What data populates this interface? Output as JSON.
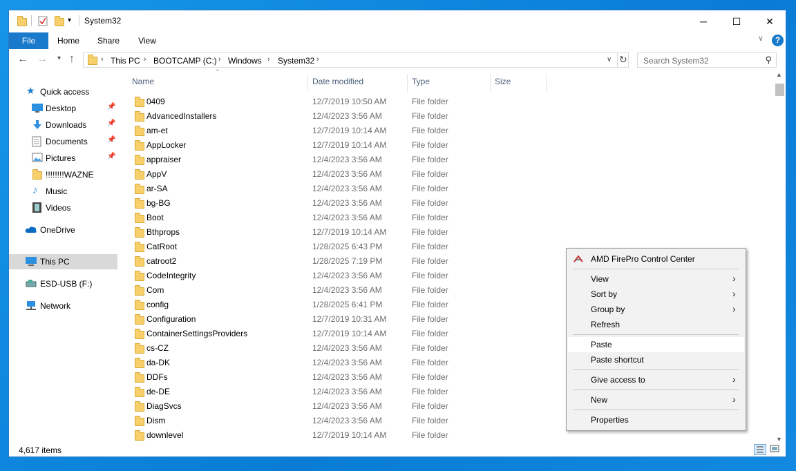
{
  "window": {
    "title": "System32",
    "controls": {
      "minimize": "─",
      "maximize": "☐",
      "close": "✕"
    }
  },
  "ribbon": {
    "tabs": [
      "File",
      "Home",
      "Share",
      "View"
    ],
    "help": "?"
  },
  "address": {
    "crumbs": [
      "This PC",
      "BOOTCAMP (C:)",
      "Windows",
      "System32"
    ],
    "search_placeholder": "Search System32"
  },
  "sidebar": {
    "quick_access": "Quick access",
    "items": [
      {
        "label": "Desktop",
        "icon": "desktop-icon",
        "pinned": true
      },
      {
        "label": "Downloads",
        "icon": "downloads-icon",
        "pinned": true
      },
      {
        "label": "Documents",
        "icon": "documents-icon",
        "pinned": true
      },
      {
        "label": "Pictures",
        "icon": "pictures-icon",
        "pinned": true
      },
      {
        "label": "!!!!!!!!WAZNE",
        "icon": "folder-icon",
        "pinned": false
      },
      {
        "label": "Music",
        "icon": "music-icon",
        "pinned": false
      },
      {
        "label": "Videos",
        "icon": "videos-icon",
        "pinned": false
      }
    ],
    "onedrive": "OneDrive",
    "this_pc": "This PC",
    "usb": "ESD-USB (F:)",
    "network": "Network"
  },
  "columns": {
    "name": "Name",
    "date": "Date modified",
    "type": "Type",
    "size": "Size"
  },
  "files": [
    {
      "name": "0409",
      "date": "12/7/2019 10:50 AM",
      "type": "File folder"
    },
    {
      "name": "AdvancedInstallers",
      "date": "12/4/2023 3:56 AM",
      "type": "File folder"
    },
    {
      "name": "am-et",
      "date": "12/7/2019 10:14 AM",
      "type": "File folder"
    },
    {
      "name": "AppLocker",
      "date": "12/7/2019 10:14 AM",
      "type": "File folder"
    },
    {
      "name": "appraiser",
      "date": "12/4/2023 3:56 AM",
      "type": "File folder"
    },
    {
      "name": "AppV",
      "date": "12/4/2023 3:56 AM",
      "type": "File folder"
    },
    {
      "name": "ar-SA",
      "date": "12/4/2023 3:56 AM",
      "type": "File folder"
    },
    {
      "name": "bg-BG",
      "date": "12/4/2023 3:56 AM",
      "type": "File folder"
    },
    {
      "name": "Boot",
      "date": "12/4/2023 3:56 AM",
      "type": "File folder"
    },
    {
      "name": "Bthprops",
      "date": "12/7/2019 10:14 AM",
      "type": "File folder"
    },
    {
      "name": "CatRoot",
      "date": "1/28/2025 6:43 PM",
      "type": "File folder"
    },
    {
      "name": "catroot2",
      "date": "1/28/2025 7:19 PM",
      "type": "File folder"
    },
    {
      "name": "CodeIntegrity",
      "date": "12/4/2023 3:56 AM",
      "type": "File folder"
    },
    {
      "name": "Com",
      "date": "12/4/2023 3:56 AM",
      "type": "File folder"
    },
    {
      "name": "config",
      "date": "1/28/2025 6:41 PM",
      "type": "File folder"
    },
    {
      "name": "Configuration",
      "date": "12/7/2019 10:31 AM",
      "type": "File folder"
    },
    {
      "name": "ContainerSettingsProviders",
      "date": "12/7/2019 10:14 AM",
      "type": "File folder"
    },
    {
      "name": "cs-CZ",
      "date": "12/4/2023 3:56 AM",
      "type": "File folder"
    },
    {
      "name": "da-DK",
      "date": "12/4/2023 3:56 AM",
      "type": "File folder"
    },
    {
      "name": "DDFs",
      "date": "12/4/2023 3:56 AM",
      "type": "File folder"
    },
    {
      "name": "de-DE",
      "date": "12/4/2023 3:56 AM",
      "type": "File folder"
    },
    {
      "name": "DiagSvcs",
      "date": "12/4/2023 3:56 AM",
      "type": "File folder"
    },
    {
      "name": "Dism",
      "date": "12/4/2023 3:56 AM",
      "type": "File folder"
    },
    {
      "name": "downlevel",
      "date": "12/7/2019 10:14 AM",
      "type": "File folder"
    }
  ],
  "status": {
    "item_count": "4,617 items"
  },
  "context_menu": {
    "amd": "AMD FirePro Control Center",
    "view": "View",
    "sort_by": "Sort by",
    "group_by": "Group by",
    "refresh": "Refresh",
    "paste": "Paste",
    "paste_shortcut": "Paste shortcut",
    "give_access": "Give access to",
    "new": "New",
    "properties": "Properties"
  },
  "colors": {
    "accent": "#1979ca",
    "folder": "#f7d06b",
    "selection": "#d9d9d9"
  }
}
